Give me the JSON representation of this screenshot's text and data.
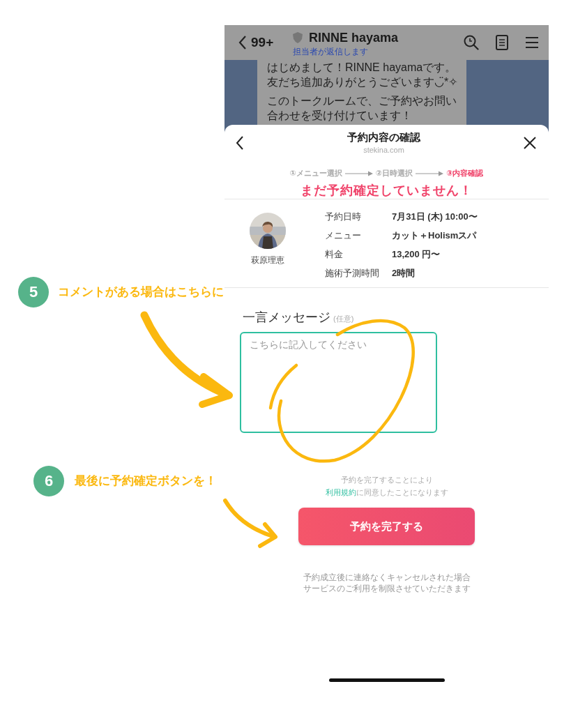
{
  "chat_header": {
    "back_label": "99+",
    "title": "RINNE hayama",
    "subtitle": "担当者が返信します"
  },
  "chat_message": {
    "paragraphs": [
      [
        "はじめまして！RINNE hayamaです。",
        "友だち追加ありがとうございます◡̈*✧"
      ],
      [
        "このトークルームで、ご予約やお問い",
        "合わせを受け付けています！"
      ]
    ]
  },
  "sheet": {
    "title": "予約内容の確認",
    "domain": "stekina.com",
    "steps": [
      {
        "label": "①メニュー選択",
        "selected": false
      },
      {
        "label": "②日時選択",
        "selected": false
      },
      {
        "label": "③内容確認",
        "selected": true
      }
    ],
    "warning": "まだ予約確定していません！",
    "staff_name": "萩原理恵",
    "details": [
      {
        "label": "予約日時",
        "value": "7月31日 (木) 10:00〜"
      },
      {
        "label": "メニュー",
        "value": "カット＋Holismスパ"
      },
      {
        "label": "料金",
        "value": "13,200 円〜"
      },
      {
        "label": "施術予測時間",
        "value": "2時間"
      }
    ],
    "message": {
      "label": "一言メッセージ",
      "optional": "(任意)",
      "placeholder": "こちらに記入してください"
    },
    "terms": {
      "line1": "予約を完了することにより",
      "link": "利用規約",
      "rest": "に同意したことになります"
    },
    "submit_button": "予約を完了する",
    "notice": [
      "予約成立後に連絡なくキャンセルされた場合",
      "サービスのご利用を制限させていただきます"
    ]
  },
  "annotations": [
    {
      "number": "5",
      "text": "コメントがある場合はこちらに"
    },
    {
      "number": "6",
      "text": "最後に予約確定ボタンを！"
    }
  ]
}
